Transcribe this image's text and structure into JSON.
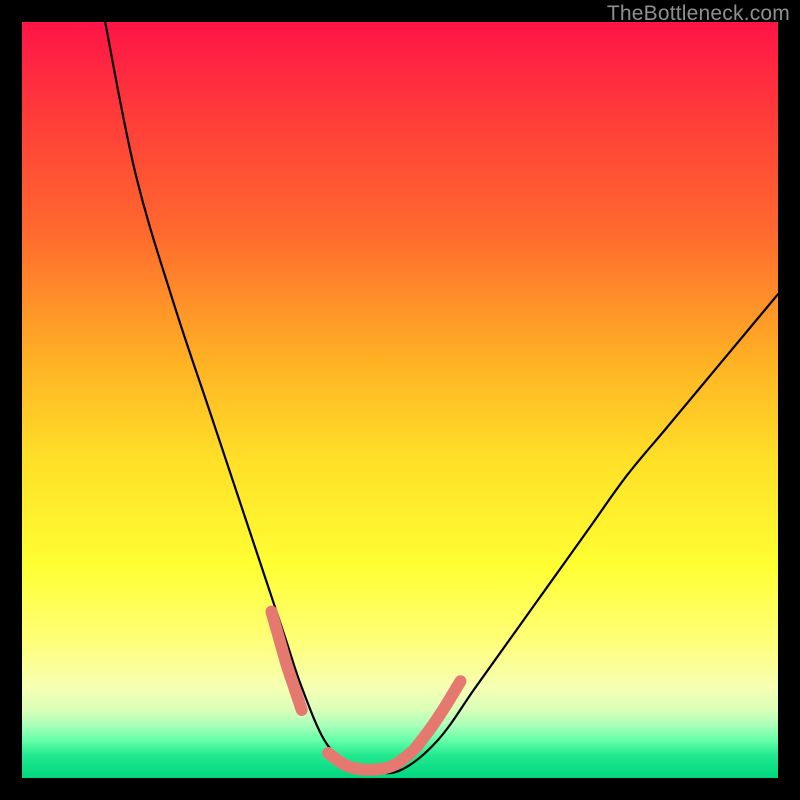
{
  "watermark": {
    "text": "TheBottleneck.com"
  },
  "chart_data": {
    "type": "line",
    "title": "",
    "xlabel": "",
    "ylabel": "",
    "xlim": [
      0,
      100
    ],
    "ylim": [
      0,
      100
    ],
    "background_gradient_stops": [
      {
        "pct": 0,
        "color": "#ff1447"
      },
      {
        "pct": 12,
        "color": "#ff3a3a"
      },
      {
        "pct": 28,
        "color": "#ff6a2d"
      },
      {
        "pct": 45,
        "color": "#ffb224"
      },
      {
        "pct": 58,
        "color": "#ffe028"
      },
      {
        "pct": 72,
        "color": "#ffff33"
      },
      {
        "pct": 82,
        "color": "#ffff7a"
      },
      {
        "pct": 88,
        "color": "#f6ffb3"
      },
      {
        "pct": 91,
        "color": "#d9ffb8"
      },
      {
        "pct": 93,
        "color": "#aaffba"
      },
      {
        "pct": 95,
        "color": "#66ffa8"
      },
      {
        "pct": 97,
        "color": "#22e98f"
      },
      {
        "pct": 100,
        "color": "#00d77e"
      }
    ],
    "series": [
      {
        "name": "bottleneck-curve",
        "note": "y is distance from bottom of plot area (0 = bottom, 100 = top)",
        "x": [
          11,
          15,
          20,
          25,
          30,
          33,
          35,
          37,
          40,
          43,
          46,
          50,
          55,
          60,
          65,
          70,
          75,
          80,
          85,
          90,
          95,
          100
        ],
        "y": [
          100,
          80,
          63,
          48,
          33,
          24,
          18,
          12,
          5,
          2,
          1,
          1,
          5,
          12,
          19,
          26,
          33,
          40,
          46,
          52,
          58,
          64
        ]
      }
    ],
    "markers": {
      "name": "highlight-arc",
      "color": "#e6796f",
      "stroke_width_px": 12,
      "note": "salmon rounded segments near the minimum",
      "segments": [
        {
          "x": [
            33.0,
            34.0,
            35.0,
            36.0,
            37.0
          ],
          "y": [
            22.0,
            18.5,
            15.0,
            12.0,
            9.0
          ]
        },
        {
          "x": [
            40.5,
            43.0,
            46.0,
            49.0,
            51.5
          ],
          "y": [
            3.3,
            1.6,
            1.1,
            1.6,
            3.4
          ]
        },
        {
          "x": [
            52.0,
            54.0,
            56.0,
            58.0
          ],
          "y": [
            3.9,
            6.5,
            9.5,
            12.8
          ]
        }
      ]
    }
  }
}
